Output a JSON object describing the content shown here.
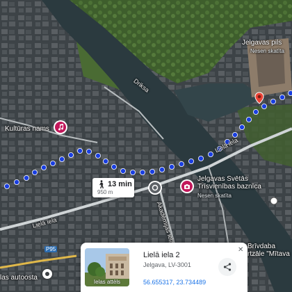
{
  "map": {
    "places": {
      "jelgava_palace": "Jelgavas pils",
      "jelgava_palace_status": "Nesen skatīta",
      "culture_house": "Kultūras nams",
      "church": "Jelgavas Svētās\nTrīsvienības baznīca",
      "church_status": "Nesen skatīta",
      "brivdabas": "Brīvdaba\nrtzāle \"Mītava",
      "bus_station": "las autoosta"
    },
    "roads": {
      "drikse": "Driksa",
      "liela_iela_a": "Lielā iela",
      "liela_iela_b": "Lielā iela",
      "akademijas": "Akadēmijas iela",
      "highway": "P95"
    },
    "route": {
      "walk_time": "13 min",
      "distance": "950 m",
      "color": "#1a3fe0"
    }
  },
  "place_card": {
    "title": "Lielā iela 2",
    "address": "Jelgava, LV-3001",
    "coordinates": "56.655317, 23.734489",
    "thumbnail_caption": "Ielas attēls",
    "close_label": "✕"
  },
  "icons": {
    "destination": "pin-icon",
    "culture": "music-icon",
    "church": "camera-icon",
    "walk": "walking-icon",
    "share": "share-icon"
  }
}
